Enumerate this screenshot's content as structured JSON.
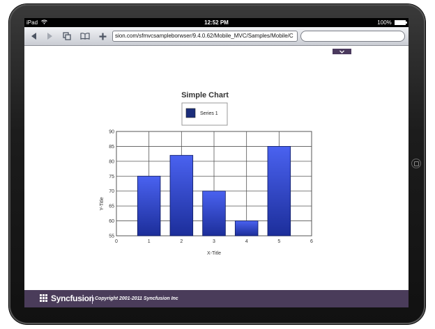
{
  "status_bar": {
    "device": "iPad",
    "time": "12:52 PM",
    "battery": "100%"
  },
  "browser": {
    "url": "sion.com/sfmvcsampleborwser/9.4.0.62/Mobile_MVC/Samples/Mobile/C",
    "search_placeholder": ""
  },
  "icons": {
    "back": "back-arrow-icon",
    "forward": "forward-arrow-icon",
    "tabs": "pages-icon",
    "bookmarks": "book-icon",
    "add": "plus-icon",
    "collapse": "chevron-down-icon"
  },
  "chart_data": {
    "type": "bar",
    "title": "Simple Chart",
    "xlabel": "X-Title",
    "ylabel": "Y-Title",
    "x": [
      1,
      2,
      3,
      4,
      5
    ],
    "series": [
      {
        "name": "Series 1",
        "values": [
          75,
          82,
          70,
          60,
          85
        ]
      }
    ],
    "xlim": [
      0,
      6
    ],
    "ylim": [
      55,
      90
    ],
    "x_ticks": [
      "0",
      "1",
      "2",
      "3",
      "4",
      "5",
      "6"
    ],
    "y_ticks": [
      "55",
      "60",
      "65",
      "70",
      "75",
      "80",
      "85",
      "90"
    ],
    "grid": true,
    "legend_position": "top-center",
    "colors": {
      "bar_top": "#4a62f0",
      "bar_bottom": "#1c2e9a",
      "legend_swatch": "#1b2d7a",
      "grid": "#555555"
    }
  },
  "footer": {
    "brand": "Syncfusion",
    "copyright": "Copyright 2001-2011 Syncfusion Inc",
    "background": "#4a3c5a"
  }
}
